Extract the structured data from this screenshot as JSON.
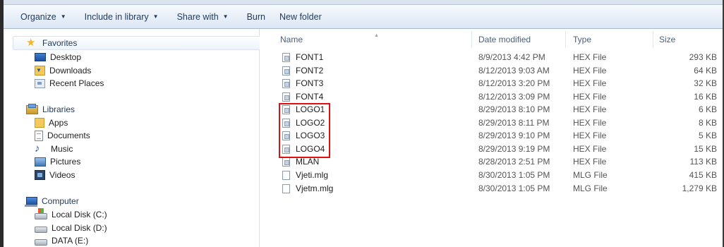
{
  "toolbar": {
    "organize_label": "Organize",
    "include_label": "Include in library",
    "share_label": "Share with",
    "burn_label": "Burn",
    "new_folder_label": "New folder"
  },
  "nav": {
    "favorites": {
      "label": "Favorites",
      "icon": "star-icon"
    },
    "favorites_items": [
      {
        "label": "Desktop",
        "icon": "desktop-icon"
      },
      {
        "label": "Downloads",
        "icon": "downloads-icon"
      },
      {
        "label": "Recent Places",
        "icon": "recent-places-icon"
      }
    ],
    "libraries": {
      "label": "Libraries",
      "icon": "libraries-icon"
    },
    "libraries_items": [
      {
        "label": "Apps",
        "icon": "folder-icon"
      },
      {
        "label": "Documents",
        "icon": "documents-icon"
      },
      {
        "label": "Music",
        "icon": "music-icon"
      },
      {
        "label": "Pictures",
        "icon": "pictures-icon"
      },
      {
        "label": "Videos",
        "icon": "videos-icon"
      }
    ],
    "computer": {
      "label": "Computer",
      "icon": "computer-icon"
    },
    "computer_items": [
      {
        "label": "Local Disk (C:)",
        "icon": "windows-disk-icon"
      },
      {
        "label": "Local Disk (D:)",
        "icon": "disk-icon"
      },
      {
        "label": "DATA (E:)",
        "icon": "disk-icon"
      }
    ]
  },
  "columns": {
    "name": "Name",
    "date": "Date modified",
    "type": "Type",
    "size": "Size"
  },
  "files": [
    {
      "name": "FONT1",
      "date": "8/9/2013 4:42 PM",
      "type": "HEX File",
      "size": "293 KB",
      "icon": "hex-file-icon"
    },
    {
      "name": "FONT2",
      "date": "8/12/2013 9:03 AM",
      "type": "HEX File",
      "size": "64 KB",
      "icon": "hex-file-icon"
    },
    {
      "name": "FONT3",
      "date": "8/12/2013 3:20 PM",
      "type": "HEX File",
      "size": "32 KB",
      "icon": "hex-file-icon"
    },
    {
      "name": "FONT4",
      "date": "8/12/2013 3:09 PM",
      "type": "HEX File",
      "size": "16 KB",
      "icon": "hex-file-icon"
    },
    {
      "name": "LOGO1",
      "date": "8/29/2013 8:10 PM",
      "type": "HEX File",
      "size": "6 KB",
      "icon": "hex-file-icon"
    },
    {
      "name": "LOGO2",
      "date": "8/29/2013 8:11 PM",
      "type": "HEX File",
      "size": "8 KB",
      "icon": "hex-file-icon"
    },
    {
      "name": "LOGO3",
      "date": "8/29/2013 9:10 PM",
      "type": "HEX File",
      "size": "5 KB",
      "icon": "hex-file-icon"
    },
    {
      "name": "LOGO4",
      "date": "8/29/2013 9:19 PM",
      "type": "HEX File",
      "size": "15 KB",
      "icon": "hex-file-icon"
    },
    {
      "name": "MLAN",
      "date": "8/28/2013 2:51 PM",
      "type": "HEX File",
      "size": "113 KB",
      "icon": "hex-file-icon"
    },
    {
      "name": "Vjeti.mlg",
      "date": "8/30/2013 1:05 PM",
      "type": "MLG File",
      "size": "415 KB",
      "icon": "blank-file-icon"
    },
    {
      "name": "Vjetm.mlg",
      "date": "8/30/2013 1:05 PM",
      "type": "MLG File",
      "size": "1,279 KB",
      "icon": "blank-file-icon"
    }
  ],
  "colors": {
    "highlight": "#e01010",
    "toolbar_text": "#1e395b",
    "header_text": "#4c607a"
  }
}
